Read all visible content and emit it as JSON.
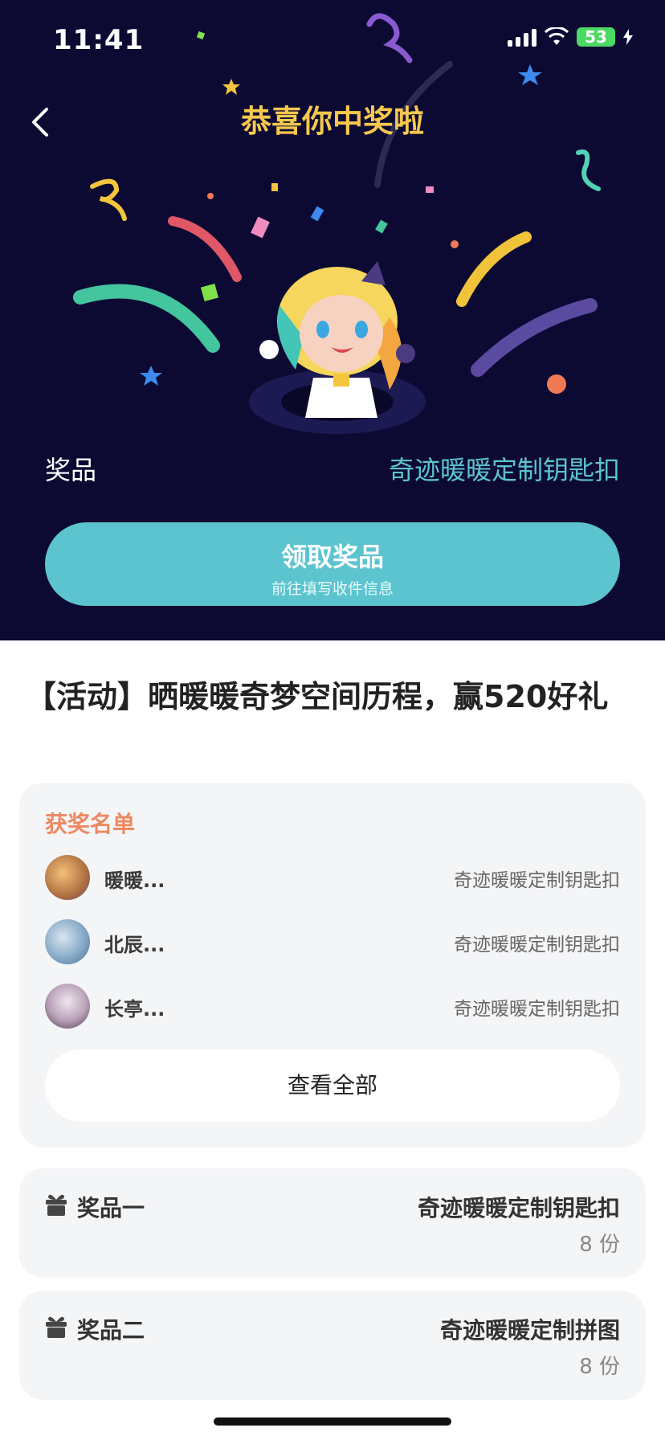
{
  "status_bar": {
    "time": "11:41",
    "battery": "53"
  },
  "header": {
    "title": "恭喜你中奖啦"
  },
  "prize": {
    "label": "奖品",
    "value": "奇迹暖暖定制钥匙扣"
  },
  "claim_button": {
    "title": "领取奖品",
    "subtitle": "前往填写收件信息"
  },
  "activity": {
    "title": "【活动】晒暖暖奇梦空间历程，赢520好礼"
  },
  "winners": {
    "heading": "获奖名单",
    "list": [
      {
        "name": "暖暖...",
        "prize": "奇迹暖暖定制钥匙扣"
      },
      {
        "name": "北辰...",
        "prize": "奇迹暖暖定制钥匙扣"
      },
      {
        "name": "长亭...",
        "prize": "奇迹暖暖定制钥匙扣"
      }
    ],
    "view_all": "查看全部"
  },
  "prizes": [
    {
      "name": "奖品一",
      "item": "奇迹暖暖定制钥匙扣",
      "count": "8 份"
    },
    {
      "name": "奖品二",
      "item": "奇迹暖暖定制拼图",
      "count": "8 份"
    }
  ],
  "colors": {
    "hero_bg": "#0c0a33",
    "accent_teal": "#5cc4cf",
    "title_gold": "#f6c84d",
    "winners_orange": "#ee8860"
  }
}
